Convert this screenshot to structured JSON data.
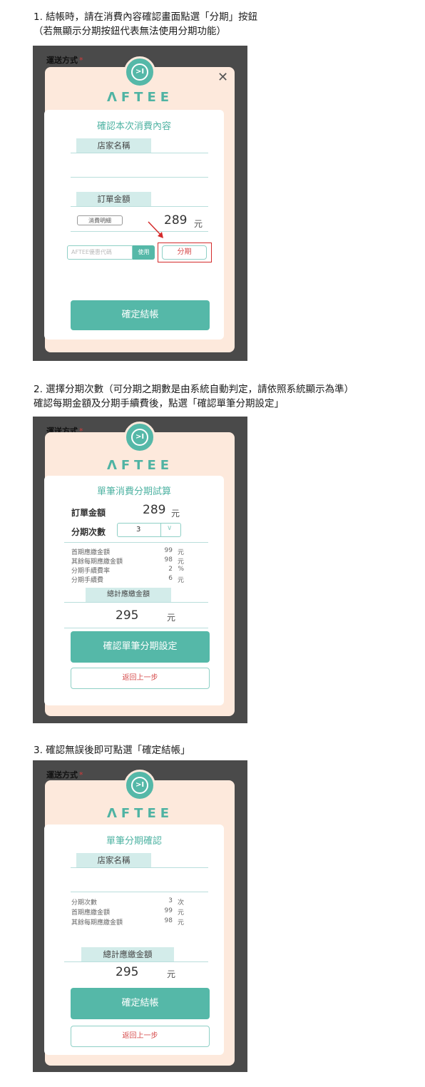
{
  "steps": [
    {
      "line1": "1. 結帳時，請在消費內容確認畫面點選「分期」按鈕",
      "line2": "（若無顯示分期按鈕代表無法使用分期功能）"
    },
    {
      "line1": "2. 選擇分期次數（可分期之期數是由系統自動判定，請依照系統顯示為準）",
      "line2": "確認每期金額及分期手續費後，點選「確認單筆分期設定」"
    },
    {
      "line1": "3. 確認無誤後即可點選「確定結帳」"
    }
  ],
  "common": {
    "shipping_label": "運送方式",
    "required_mark": "*",
    "brand": "ΛFTEE",
    "logo_glyph": ">I",
    "close_glyph": "✕"
  },
  "screen1": {
    "title": "確認本次消費內容",
    "store_tab": "店家名稱",
    "order_tab": "訂單金額",
    "details_button": "消費明細",
    "amount": "289",
    "unit": "元",
    "coupon_placeholder": "AFTEE優惠代碼",
    "use_button": "使用",
    "installment_button": "分期",
    "checkout_button": "確定結帳",
    "highlight_color": "#d42b2b"
  },
  "screen2": {
    "title": "單筆消費分期試算",
    "order_amount_label": "訂單金額",
    "order_amount": "289",
    "unit": "元",
    "installments_label": "分期次數",
    "installments_value": "3",
    "rows": [
      {
        "label": "首期應繳金額",
        "value": "99",
        "unit": "元"
      },
      {
        "label": "其餘每期應繳金額",
        "value": "98",
        "unit": "元"
      },
      {
        "label": "分期手續費率",
        "value": "2",
        "unit": "%"
      },
      {
        "label": "分期手續費",
        "value": "6",
        "unit": "元"
      }
    ],
    "total_tab": "總計應繳金額",
    "total": "295",
    "confirm_button": "確認單筆分期設定",
    "back_button": "返回上一步"
  },
  "screen3": {
    "title": "單筆分期確認",
    "store_tab": "店家名稱",
    "rows": [
      {
        "label": "分期次數",
        "value": "3",
        "unit": "次"
      },
      {
        "label": "首期應繳金額",
        "value": "99",
        "unit": "元"
      },
      {
        "label": "其餘每期應繳金額",
        "value": "98",
        "unit": "元"
      }
    ],
    "total_tab": "總計應繳金額",
    "total": "295",
    "unit": "元",
    "checkout_button": "確定結帳",
    "back_button": "返回上一步"
  }
}
